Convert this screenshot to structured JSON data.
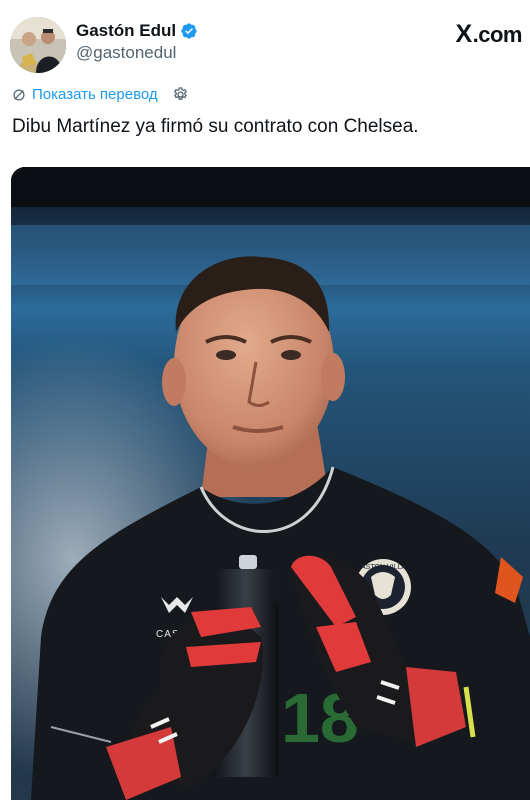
{
  "author": {
    "display_name": "Gastón Edul",
    "handle": "@gastonedul",
    "verified": true,
    "avatar_icon": "profile-photo"
  },
  "site": {
    "label": ".com",
    "mark": "X"
  },
  "translate": {
    "label": "Показать перевод",
    "icon": "translate-icon",
    "settings_icon": "gear-icon"
  },
  "tweet": {
    "text": "Dibu Martínez ya firmó su contrato con Chelsea."
  },
  "media": {
    "type": "photo",
    "jersey_text": "CASTORE",
    "crest_text": "ASTON VILLA",
    "number_text": "18"
  },
  "colors": {
    "accent": "#1d9bf0",
    "text": "#0f1419",
    "secondary": "#536471"
  }
}
